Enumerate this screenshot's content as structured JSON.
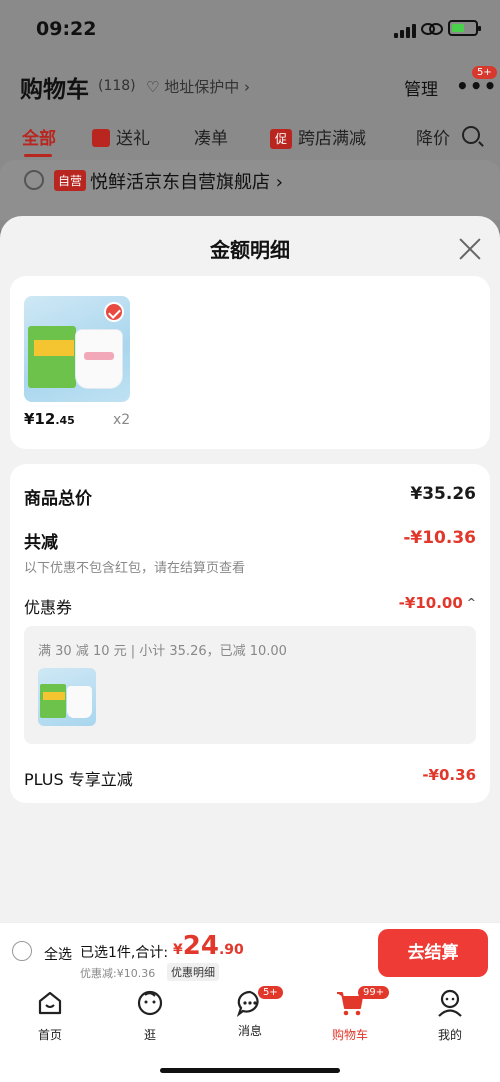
{
  "status_bar": {
    "time": "09:22"
  },
  "header": {
    "title": "购物车",
    "count": "(118)",
    "address": "地址保护中 ›",
    "manage": "管理",
    "more_badge": "5+"
  },
  "tabs": [
    {
      "label": "全部"
    },
    {
      "label": "送礼"
    },
    {
      "label": "凑单"
    },
    {
      "label": "跨店满减",
      "icon_text": "促"
    },
    {
      "label": "降价"
    }
  ],
  "store": {
    "tag": "自营",
    "name": "悦鲜活京东自营旗舰店 ›"
  },
  "sheet": {
    "title": "金额明细",
    "item": {
      "price_int": "¥12",
      "price_dec": ".45",
      "qty": "x2"
    },
    "goods_total_label": "商品总价",
    "goods_total_value": "¥35.26",
    "reduce_label": "共减",
    "reduce_value": "-¥10.36",
    "hint": "以下优惠不包含红包，请在结算页查看",
    "coupon_label": "优惠券",
    "coupon_value": "-¥10.00",
    "coupon_desc": "满 30 减 10 元 | 小计 35.26，已减 10.00",
    "plus_label": "PLUS 专享立减",
    "plus_value": "-¥0.36"
  },
  "checkout": {
    "select_all": "全选",
    "selected": "已选1件,合计:",
    "total_currency": "¥",
    "total_int": "24",
    "total_dec": ".90",
    "discount": "优惠减:¥10.36",
    "detail": "优惠明细",
    "pay_button": "去结算"
  },
  "tabbar": [
    {
      "label": "首页",
      "icon": "home-icon"
    },
    {
      "label": "逛",
      "icon": "explore-icon"
    },
    {
      "label": "消息",
      "icon": "message-icon",
      "badge": "5+"
    },
    {
      "label": "购物车",
      "icon": "cart-icon",
      "badge": "99+",
      "active": true
    },
    {
      "label": "我的",
      "icon": "profile-icon"
    }
  ],
  "colors": {
    "accent": "#e2372b",
    "brand_red": "#b8261f",
    "pay_button": "#ef3b36"
  }
}
